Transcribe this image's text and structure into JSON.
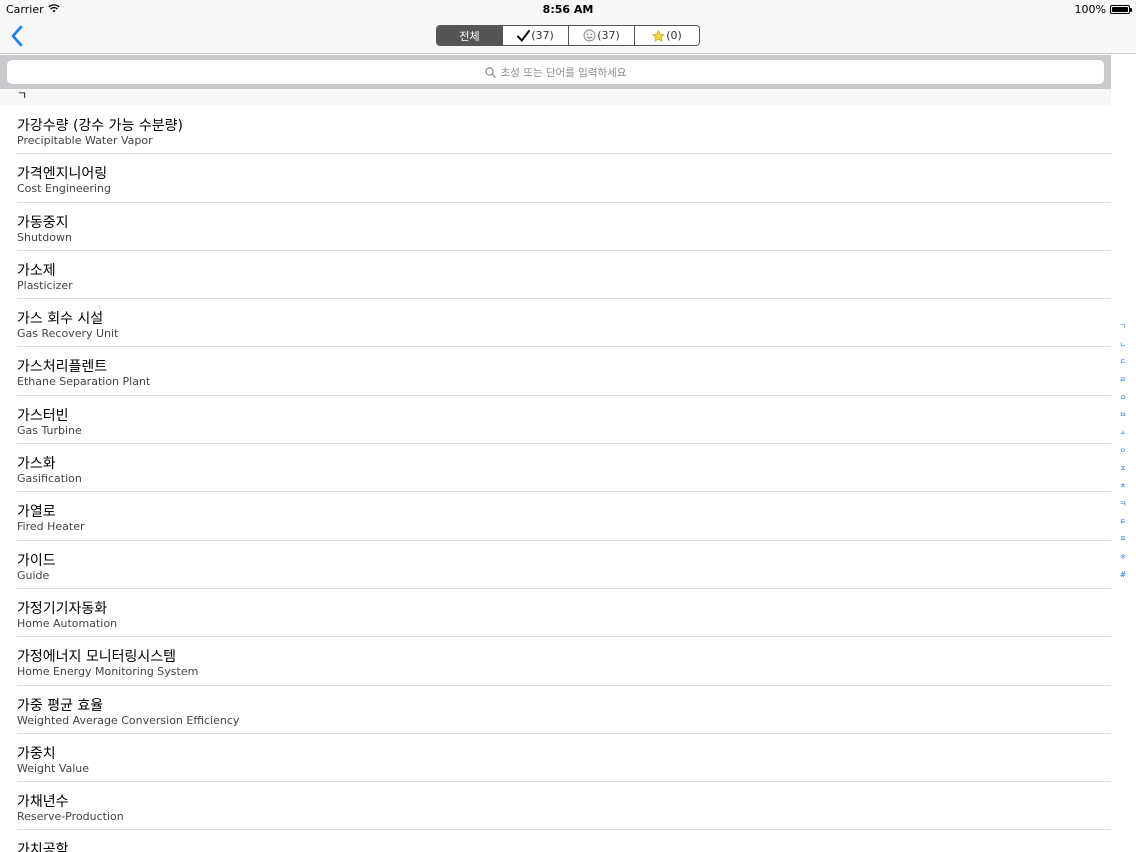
{
  "status_bar": {
    "carrier": "Carrier",
    "time": "8:56 AM",
    "battery": "100%",
    "battery_level": 1.0
  },
  "nav": {
    "back_icon": "chevron-left-icon",
    "accent_color": "#1a7bf2",
    "segments": [
      {
        "label": "전체",
        "icon": "",
        "active": true
      },
      {
        "label": "(37)",
        "icon": "checkmark-icon",
        "active": false
      },
      {
        "label": "(37)",
        "icon": "smiley-icon",
        "active": false
      },
      {
        "label": "(0)",
        "icon": "star-icon",
        "active": false
      }
    ]
  },
  "search": {
    "placeholder": "초성 또는 단어를 입력하세요",
    "icon": "search-icon"
  },
  "section": {
    "header": "ㄱ"
  },
  "rows": [
    {
      "title": "가강수량 (강수 가능 수분량)",
      "subtitle": "Precipitable Water Vapor"
    },
    {
      "title": "가격엔지니어링",
      "subtitle": "Cost Engineering"
    },
    {
      "title": "가동중지",
      "subtitle": "Shutdown"
    },
    {
      "title": "가소제",
      "subtitle": "Plasticizer"
    },
    {
      "title": "가스 회수 시설",
      "subtitle": "Gas Recovery Unit"
    },
    {
      "title": "가스처리플렌트",
      "subtitle": "Ethane Separation Plant"
    },
    {
      "title": "가스터빈",
      "subtitle": "Gas Turbine"
    },
    {
      "title": "가스화",
      "subtitle": "Gasification"
    },
    {
      "title": "가열로",
      "subtitle": "Fired Heater"
    },
    {
      "title": "가이드",
      "subtitle": "Guide"
    },
    {
      "title": "가정기기자동화",
      "subtitle": "Home Automation"
    },
    {
      "title": "가정에너지 모니터링시스템",
      "subtitle": "Home Energy Monitoring System"
    },
    {
      "title": "가중 평균 효율",
      "subtitle": "Weighted Average Conversion Efficiency"
    },
    {
      "title": "가중치",
      "subtitle": "Weight Value"
    },
    {
      "title": "가채년수",
      "subtitle": "Reserve-Production"
    },
    {
      "title": "가치공학",
      "subtitle": ""
    }
  ],
  "index": [
    "ㄱ",
    "ㄴ",
    "ㄷ",
    "ㄹ",
    "ㅁ",
    "ㅂ",
    "ㅅ",
    "ㅇ",
    "ㅈ",
    "ㅊ",
    "ㅋ",
    "ㅌ",
    "ㅍ",
    "ㅎ",
    "#"
  ]
}
